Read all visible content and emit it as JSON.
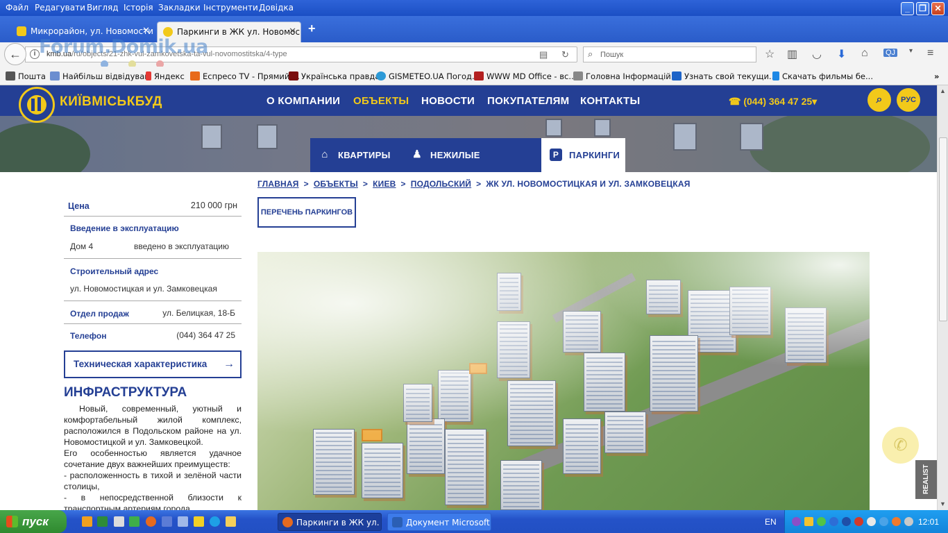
{
  "browser": {
    "menu": [
      "Файл",
      "Редагувати",
      "Вигляд",
      "Історія",
      "Закладки",
      "Інструменти",
      "Довідка"
    ],
    "tabs": [
      {
        "title": "Микрорайон, ул. Новомости..."
      },
      {
        "title": "Паркинги в ЖК ул. Новомос..."
      }
    ],
    "url_host": "kmb.ua",
    "url_path": "/ru/objects/21-zhk-vul-zamkovetska-ta-vul-novomostitska/4-type",
    "search_placeholder": "Пошук",
    "watermark": "Forum.Domik.ua",
    "bookmarks": [
      "Пошта",
      "Найбільш відвідувані",
      "Яндекс",
      "Еспресо TV - Прямий ...",
      "Українська правда",
      "GISMETEO.UA Погод...",
      "WWW MD Office - вс...",
      "Головна  Інформацій...",
      "Узнать свой текущи...",
      "Скачать фильмы бе..."
    ]
  },
  "site": {
    "logo_text": "КИЇВМІСЬКБУД",
    "nav": [
      "О КОМПАНИИ",
      "ОБЪЕКТЫ",
      "НОВОСТИ",
      "ПОКУПАТЕЛЯМ",
      "КОНТАКТЫ"
    ],
    "phone": "☎ (044) 364 47 25▾",
    "lang": "РУС",
    "subnav": [
      "КВАРТИРЫ",
      "НЕЖИЛЫЕ ПОМЕЩЕНИЯ",
      "ПАРКИНГИ"
    ],
    "breadcrumbs": [
      "ГЛАВНАЯ",
      "ОБЪЕКТЫ",
      "КИЕВ",
      "ПОДОЛЬСКИЙ",
      "ЖК УЛ. НОВОМОСТИЦКАЯ И УЛ. ЗАМКОВЕЦКАЯ"
    ],
    "list_button": "ПЕРЕЧЕНЬ ПАРКИНГОВ",
    "sidebar": {
      "price_label": "Цена",
      "price_value": "210 000 грн",
      "commission_label": "Введение в эксплуатацию",
      "house": "Дом 4",
      "commission_status": "введено в эксплуатацию",
      "address_label": "Строительный адрес",
      "address_value": "ул. Новомостицкая и ул. Замковецкая",
      "sales_label": "Отдел продаж",
      "sales_value": "ул. Белицкая, 18-Б",
      "phone_label": "Телефон",
      "phone_value": "(044) 364 47 25",
      "tech_button": "Техническая характеристика",
      "infra_title": "ИНФРАСТРУКТУРА",
      "infra_text": "Новый, современный, уютный и комфортабельный жилой комплекс, расположился в Подольском районе на ул. Новомостицкой и ул. Замковецкой.",
      "infra_text2": "Его особенностью является удачное сочетание двух важнейших преимуществ:",
      "infra_text3": "- расположенность в тихой и зелёной части столицы,",
      "infra_text4": "- в непосредственной близости к транспортным артериям города."
    },
    "realist_badge": "REALIST"
  },
  "taskbar": {
    "start": "пуск",
    "tasks": [
      "Паркинги в ЖК ул. ...",
      "Документ Microsoft ..."
    ],
    "lang": "EN",
    "time": "12:01"
  }
}
